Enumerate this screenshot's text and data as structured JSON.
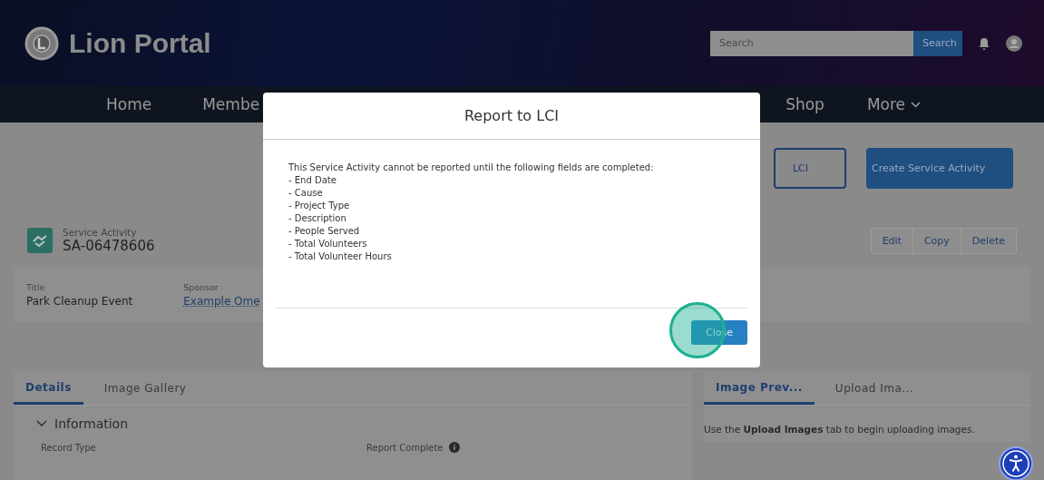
{
  "header": {
    "title": "Lion Portal",
    "search": {
      "placeholder": "Search",
      "button": "Search"
    }
  },
  "nav": {
    "items": [
      {
        "label": "Home",
        "kind": "link"
      },
      {
        "label": "Membe",
        "kind": "link"
      },
      {
        "label": "Shop",
        "kind": "link"
      },
      {
        "label": "More",
        "kind": "menu"
      }
    ]
  },
  "actions": {
    "buttons": [
      {
        "label": "LCI",
        "kind": "outline"
      },
      {
        "label": "Create Service Activity",
        "kind": "brand"
      }
    ]
  },
  "record": {
    "type": "Service Activity",
    "name": "SA-06478606",
    "buttons": [
      "Edit",
      "Copy",
      "Delete"
    ]
  },
  "highlights": [
    {
      "label": "Title",
      "value": "Park Cleanup Event",
      "kind": "text"
    },
    {
      "label": "Sponsor",
      "value": "Example Ome",
      "kind": "link"
    }
  ],
  "details": {
    "tabs": [
      {
        "label": "Details",
        "selected": true
      },
      {
        "label": "Image Gallery",
        "selected": false
      }
    ],
    "section": {
      "title": "Information",
      "expanded": true
    },
    "fields": [
      {
        "label": "Record Type",
        "info": false
      },
      {
        "label": "Report Complete",
        "info": true
      }
    ]
  },
  "images": {
    "tabs": [
      {
        "label": "Image Prev...",
        "selected": true
      },
      {
        "label": "Upload Ima...",
        "selected": false
      }
    ],
    "message": "Use the **Upload Images** tab to begin uploading images."
  },
  "modal": {
    "title": "Report to LCI",
    "intro": "This Service Activity cannot be reported until the following fields are completed:",
    "missing": [
      "- End Date",
      "- Cause",
      "- Project Type",
      "- Description",
      "- People Served",
      "- Total Volunteers",
      "- Total Volunteer Hours"
    ],
    "button": "Close",
    "highlighted": true
  }
}
